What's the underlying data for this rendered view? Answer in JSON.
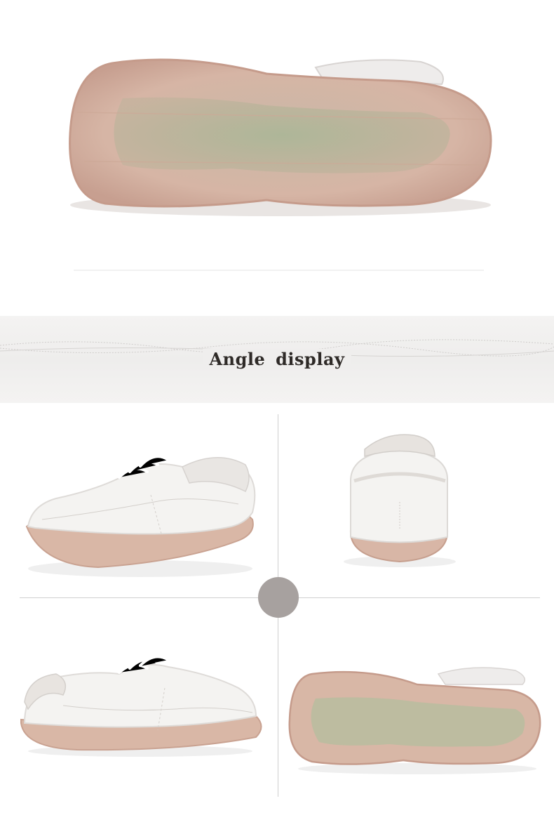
{
  "banner": {
    "title": "Angle display"
  },
  "colors": {
    "sole": "#d9b7a8",
    "sole_inner": "#b9bfa1",
    "leather": "#f3f2f0",
    "divider_dot": "#a7a19f"
  },
  "photos": [
    {
      "name": "sole-bottom-view"
    },
    {
      "name": "shoe-side-front-view"
    },
    {
      "name": "shoe-heel-back-view"
    },
    {
      "name": "shoe-side-view-left"
    },
    {
      "name": "sole-bottom-view-small"
    }
  ]
}
